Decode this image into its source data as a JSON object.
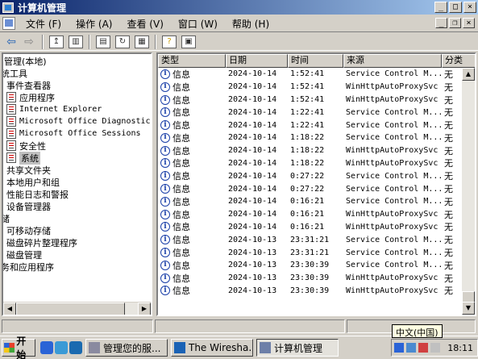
{
  "window": {
    "title": "计算机管理"
  },
  "menu": [
    "文件(F)",
    "操作(A)",
    "查看(V)",
    "窗口(W)",
    "帮助(H)"
  ],
  "menu_display": [
    "文件 (F)",
    "操作 (A)",
    "查看 (V)",
    "窗口 (W)",
    "帮助 (H)"
  ],
  "tree": [
    {
      "label": "管理(本地)"
    },
    {
      "label": "统工具"
    },
    {
      "label": "事件查看器"
    },
    {
      "label": "应用程序"
    },
    {
      "label": "Internet Explorer"
    },
    {
      "label": "Microsoft Office Diagnostics"
    },
    {
      "label": "Microsoft Office Sessions"
    },
    {
      "label": "安全性"
    },
    {
      "label": "系统"
    },
    {
      "label": "共享文件夹"
    },
    {
      "label": "本地用户和组"
    },
    {
      "label": "性能日志和警报"
    },
    {
      "label": "设备管理器"
    },
    {
      "label": "储"
    },
    {
      "label": "可移动存储"
    },
    {
      "label": "磁盘碎片整理程序"
    },
    {
      "label": "磁盘管理"
    },
    {
      "label": "务和应用程序"
    }
  ],
  "columns": [
    "类型",
    "日期",
    "时间",
    "来源",
    "分类"
  ],
  "events": [
    {
      "type": "信息",
      "date": "2024-10-14",
      "time": "1:52:41",
      "source": "Service Control M...",
      "category": "无"
    },
    {
      "type": "信息",
      "date": "2024-10-14",
      "time": "1:52:41",
      "source": "WinHttpAutoProxySvc",
      "category": "无"
    },
    {
      "type": "信息",
      "date": "2024-10-14",
      "time": "1:52:41",
      "source": "WinHttpAutoProxySvc",
      "category": "无"
    },
    {
      "type": "信息",
      "date": "2024-10-14",
      "time": "1:22:41",
      "source": "Service Control M...",
      "category": "无"
    },
    {
      "type": "信息",
      "date": "2024-10-14",
      "time": "1:22:41",
      "source": "Service Control M...",
      "category": "无"
    },
    {
      "type": "信息",
      "date": "2024-10-14",
      "time": "1:18:22",
      "source": "Service Control M...",
      "category": "无"
    },
    {
      "type": "信息",
      "date": "2024-10-14",
      "time": "1:18:22",
      "source": "WinHttpAutoProxySvc",
      "category": "无"
    },
    {
      "type": "信息",
      "date": "2024-10-14",
      "time": "1:18:22",
      "source": "WinHttpAutoProxySvc",
      "category": "无"
    },
    {
      "type": "信息",
      "date": "2024-10-14",
      "time": "0:27:22",
      "source": "Service Control M...",
      "category": "无"
    },
    {
      "type": "信息",
      "date": "2024-10-14",
      "time": "0:27:22",
      "source": "Service Control M...",
      "category": "无"
    },
    {
      "type": "信息",
      "date": "2024-10-14",
      "time": "0:16:21",
      "source": "Service Control M...",
      "category": "无"
    },
    {
      "type": "信息",
      "date": "2024-10-14",
      "time": "0:16:21",
      "source": "WinHttpAutoProxySvc",
      "category": "无"
    },
    {
      "type": "信息",
      "date": "2024-10-14",
      "time": "0:16:21",
      "source": "WinHttpAutoProxySvc",
      "category": "无"
    },
    {
      "type": "信息",
      "date": "2024-10-13",
      "time": "23:31:21",
      "source": "Service Control M...",
      "category": "无"
    },
    {
      "type": "信息",
      "date": "2024-10-13",
      "time": "23:31:21",
      "source": "Service Control M...",
      "category": "无"
    },
    {
      "type": "信息",
      "date": "2024-10-13",
      "time": "23:30:39",
      "source": "Service Control M...",
      "category": "无"
    },
    {
      "type": "信息",
      "date": "2024-10-13",
      "time": "23:30:39",
      "source": "WinHttpAutoProxySvc",
      "category": "无"
    },
    {
      "type": "信息",
      "date": "2024-10-13",
      "time": "23:30:39",
      "source": "WinHttpAutoProxySvc",
      "category": "无"
    }
  ],
  "taskbar": {
    "start_label": "开始",
    "tasks": [
      "管理您的服...",
      "The Wiresha...",
      "计算机管理"
    ],
    "tooltip": "中文(中国)",
    "clock": "18:11"
  },
  "colors": {
    "title_start": "#0a246a",
    "title_end": "#a6caf0",
    "info_icon": "#1a3fa8"
  }
}
